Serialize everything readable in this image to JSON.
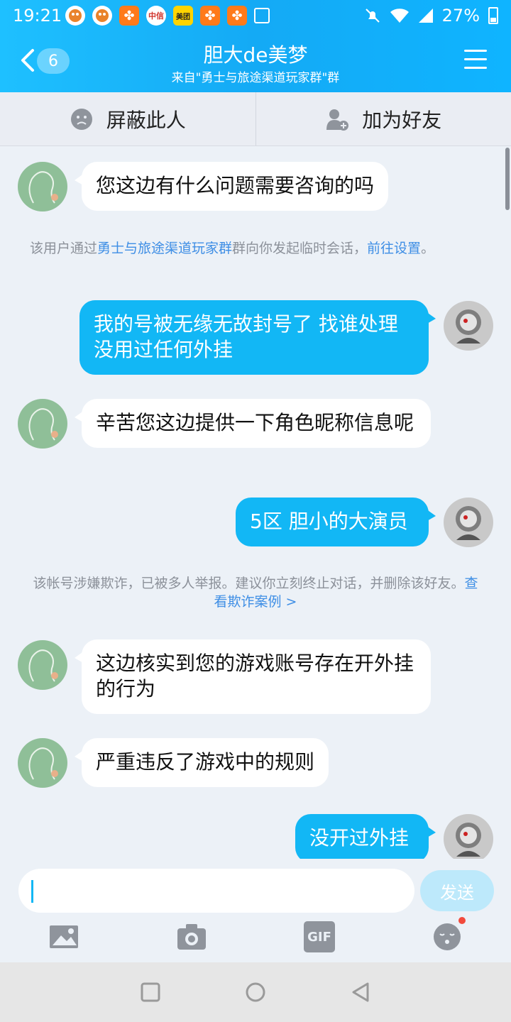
{
  "status": {
    "time": "19:21",
    "battery": "27%",
    "notif_app_labels": [
      "美团",
      "中信"
    ]
  },
  "header": {
    "back_badge": "6",
    "title": "胆大de美梦",
    "subtitle": "来自\"勇士与旅途渠道玩家群\"群"
  },
  "actions": {
    "block": "屏蔽此人",
    "add_friend": "加为好友"
  },
  "messages": [
    {
      "side": "in",
      "text": "您这边有什么问题需要咨询的吗"
    },
    {
      "side": "out",
      "text": "我的号被无缘无故封号了 找谁处理 没用过任何外挂"
    },
    {
      "side": "in",
      "text": "辛苦您这边提供一下角色昵称信息呢"
    },
    {
      "side": "out",
      "text": "5区 胆小的大演员"
    },
    {
      "side": "in",
      "text": "这边核实到您的游戏账号存在开外挂的行为"
    },
    {
      "side": "in",
      "text": "严重违反了游戏中的规则"
    },
    {
      "side": "out",
      "text": "没开过外挂"
    }
  ],
  "system_notes": {
    "temp_chat": {
      "prefix": "该用户通过",
      "group_link": "勇士与旅途渠道玩家群",
      "middle": "群向你发起临时会话，",
      "settings_link": "前往设置",
      "suffix": "。"
    },
    "fraud_warning": {
      "text": "该帐号涉嫌欺诈，已被多人举报。建议你立刻终止对话，并删除该好友。",
      "link": "查看欺诈案例 >"
    }
  },
  "input": {
    "send_label": "发送",
    "gif_label": "GIF"
  },
  "colors": {
    "header": "#14aaf5",
    "out_bubble": "#12b7f5",
    "in_bubble": "#ffffff",
    "link": "#3e8ee5",
    "background": "#ecf1f7"
  }
}
